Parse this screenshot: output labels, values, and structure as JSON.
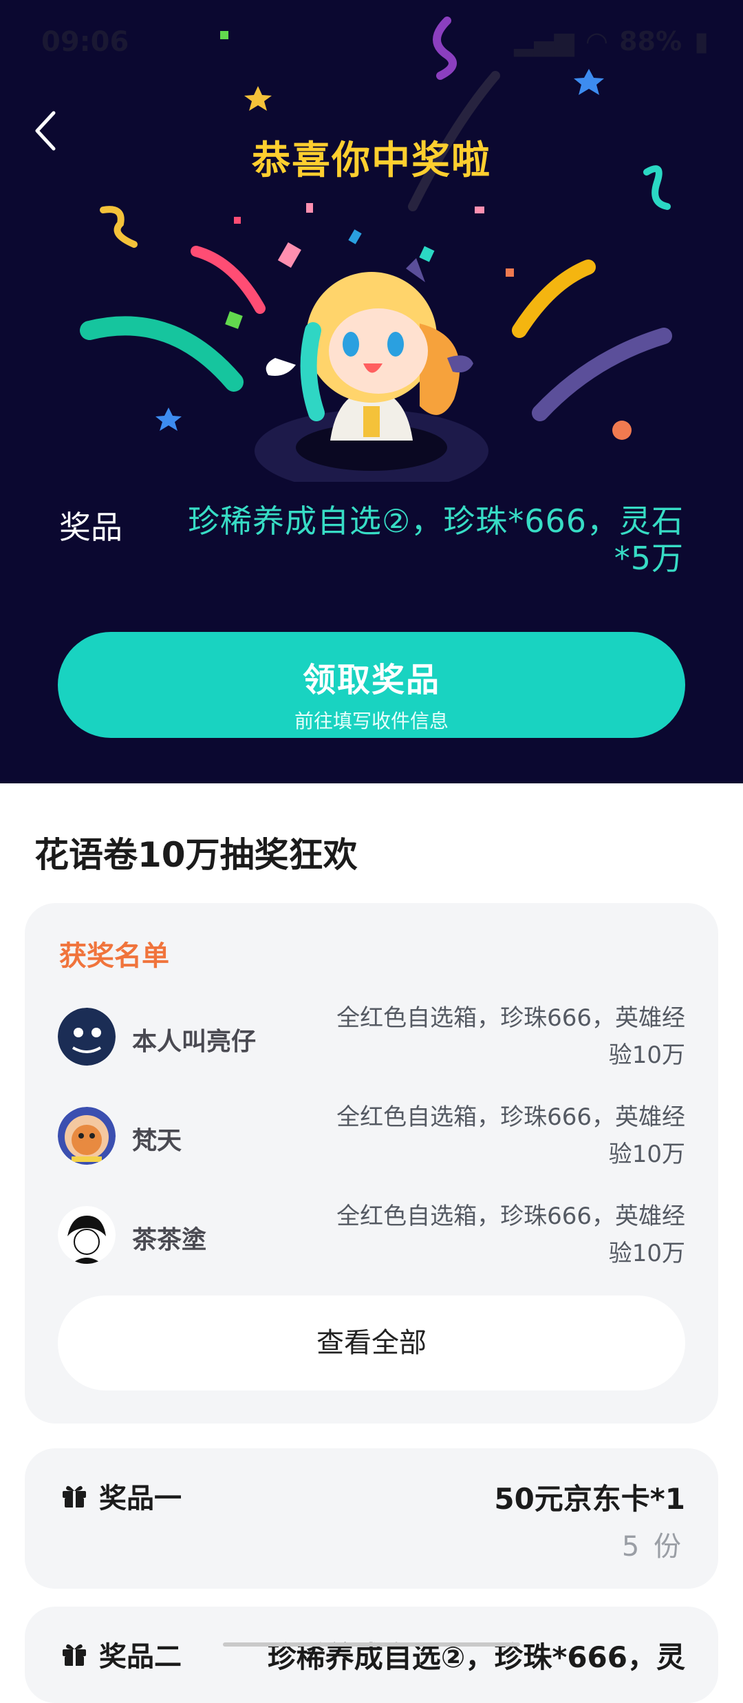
{
  "status_bar": {
    "time": "09:06",
    "battery": "88%"
  },
  "hero": {
    "title": "恭喜你中奖啦",
    "prize_label": "奖品",
    "prize_value": "珍稀养成自选②，珍珠*666，灵石*5万",
    "claim_button": {
      "label": "领取奖品",
      "sublabel": "前往填写收件信息"
    }
  },
  "event": {
    "title": "花语卷10万抽奖狂欢"
  },
  "winners": {
    "title": "获奖名单",
    "list": [
      {
        "name": "本人叫亮仔",
        "reward": "全红色自选箱，珍珠666，英雄经验10万"
      },
      {
        "name": "梵天",
        "reward": "全红色自选箱，珍珠666，英雄经验10万"
      },
      {
        "name": "茶茶塗",
        "reward": "全红色自选箱，珍珠666，英雄经验10万"
      }
    ],
    "view_all": "查看全部"
  },
  "prizes": [
    {
      "name": "奖品一",
      "value": "50元京东卡*1",
      "count": "5 份"
    },
    {
      "name": "奖品二",
      "value": "珍稀养成自选②，珍珠*666，灵"
    }
  ],
  "colors": {
    "hero_bg": "#0b0830",
    "accent": "#19d3c1",
    "title_yellow": "#ffcf2f",
    "winners_orange": "#f0743c"
  }
}
